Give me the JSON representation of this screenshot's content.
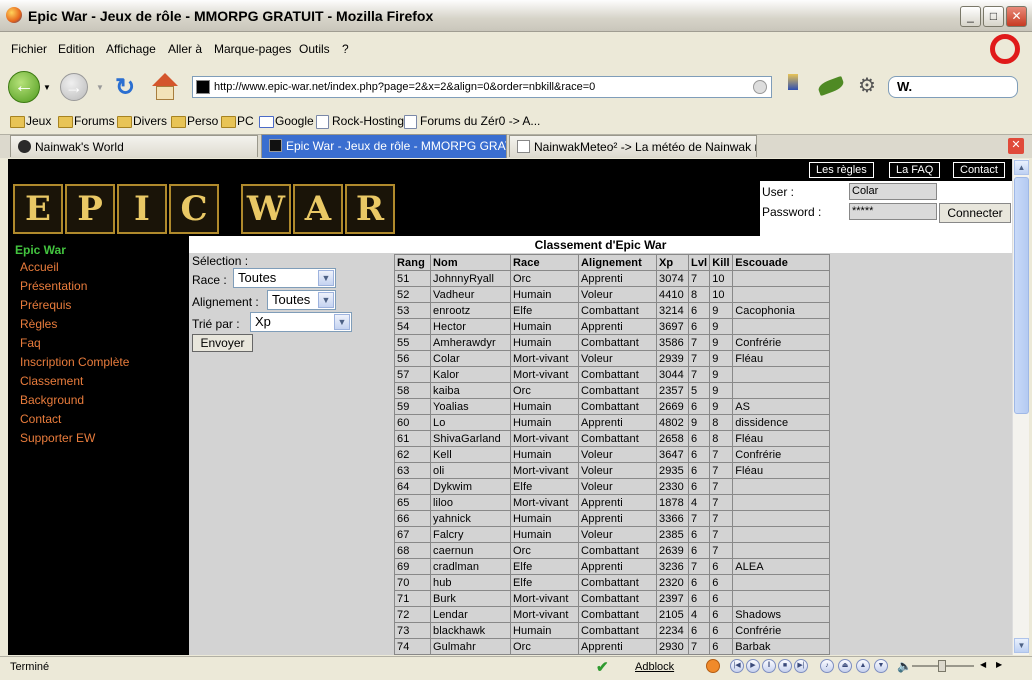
{
  "window": {
    "title": "Epic War - Jeux de rôle - MMORPG GRATUIT - Mozilla Firefox",
    "minimize": "_",
    "maximize": "□",
    "close": "✕"
  },
  "menu": [
    "Fichier",
    "Edition",
    "Affichage",
    "Aller à",
    "Marque-pages",
    "Outils",
    "?"
  ],
  "url": "http://www.epic-war.net/index.php?page=2&x=2&align=0&order=nbkill&race=0",
  "search_engine_label": "W.",
  "bookmarks": [
    {
      "label": "Jeux",
      "kind": "folder"
    },
    {
      "label": "Forums",
      "kind": "folder"
    },
    {
      "label": "Divers",
      "kind": "folder"
    },
    {
      "label": "Perso",
      "kind": "folder"
    },
    {
      "label": "PC",
      "kind": "folder"
    },
    {
      "label": "Google",
      "kind": "google"
    },
    {
      "label": "Rock-Hosting",
      "kind": "page"
    },
    {
      "label": "Forums du Zér0 -> A...",
      "kind": "page"
    }
  ],
  "tabs": [
    {
      "label": "Nainwak's World",
      "active": false
    },
    {
      "label": "Epic War - Jeux de rôle - MMORPG GRATUIT",
      "active": true
    },
    {
      "label": "NainwakMeteo² -> La météo de Nainwak re...",
      "active": false
    }
  ],
  "page": {
    "logo_letters": [
      "E",
      "P",
      "I",
      "C",
      "W",
      "A",
      "R"
    ],
    "top_links": [
      "Les règles",
      "La FAQ",
      "Contact"
    ],
    "login": {
      "user_label": "User :",
      "user_value": "Colar",
      "password_label": "Password :",
      "password_value": "*****",
      "connect_label": "Connecter"
    },
    "sidebar_title": "Epic War",
    "sidebar_items": [
      "Accueil",
      "Présentation",
      "Prérequis",
      "Règles",
      "Faq",
      "Inscription Complète",
      "Classement",
      "Background",
      "Contact",
      "Supporter EW"
    ],
    "ranking_title": "Classement d'Epic War",
    "filters": {
      "selection_label": "Sélection :",
      "race_label": "Race :",
      "race_value": "Toutes",
      "alignment_label": "Alignement :",
      "alignment_value": "Toutes",
      "sort_label": "Trié par :",
      "sort_value": "Xp",
      "submit_label": "Envoyer"
    },
    "table": {
      "headers": [
        "Rang",
        "Nom",
        "Race",
        "Alignement",
        "Xp",
        "Lvl",
        "Kill",
        "Escouade"
      ],
      "rows": [
        [
          "51",
          "JohnnyRyall",
          "Orc",
          "Apprenti",
          "3074",
          "7",
          "10",
          ""
        ],
        [
          "52",
          "Vadheur",
          "Humain",
          "Voleur",
          "4410",
          "8",
          "10",
          ""
        ],
        [
          "53",
          "enrootz",
          "Elfe",
          "Combattant",
          "3214",
          "6",
          "9",
          "Cacophonia"
        ],
        [
          "54",
          "Hector",
          "Humain",
          "Apprenti",
          "3697",
          "6",
          "9",
          ""
        ],
        [
          "55",
          "Amherawdyr",
          "Humain",
          "Combattant",
          "3586",
          "7",
          "9",
          "Confrérie"
        ],
        [
          "56",
          "Colar",
          "Mort-vivant",
          "Voleur",
          "2939",
          "7",
          "9",
          "Fléau"
        ],
        [
          "57",
          "Kalor",
          "Mort-vivant",
          "Combattant",
          "3044",
          "7",
          "9",
          ""
        ],
        [
          "58",
          "kaiba",
          "Orc",
          "Combattant",
          "2357",
          "5",
          "9",
          ""
        ],
        [
          "59",
          "Yoalias",
          "Humain",
          "Combattant",
          "2669",
          "6",
          "9",
          "AS"
        ],
        [
          "60",
          "Lo",
          "Humain",
          "Apprenti",
          "4802",
          "9",
          "8",
          "dissidence"
        ],
        [
          "61",
          "ShivaGarland",
          "Mort-vivant",
          "Combattant",
          "2658",
          "6",
          "8",
          "Fléau"
        ],
        [
          "62",
          "Kell",
          "Humain",
          "Voleur",
          "3647",
          "6",
          "7",
          "Confrérie"
        ],
        [
          "63",
          "oli",
          "Mort-vivant",
          "Voleur",
          "2935",
          "6",
          "7",
          "Fléau"
        ],
        [
          "64",
          "Dykwim",
          "Elfe",
          "Voleur",
          "2330",
          "6",
          "7",
          ""
        ],
        [
          "65",
          "liloo",
          "Mort-vivant",
          "Apprenti",
          "1878",
          "4",
          "7",
          ""
        ],
        [
          "66",
          "yahnick",
          "Humain",
          "Apprenti",
          "3366",
          "7",
          "7",
          ""
        ],
        [
          "67",
          "Falcry",
          "Humain",
          "Voleur",
          "2385",
          "6",
          "7",
          ""
        ],
        [
          "68",
          "caernun",
          "Orc",
          "Combattant",
          "2639",
          "6",
          "7",
          ""
        ],
        [
          "69",
          "cradlman",
          "Elfe",
          "Apprenti",
          "3236",
          "7",
          "6",
          "ALEA"
        ],
        [
          "70",
          "hub",
          "Elfe",
          "Combattant",
          "2320",
          "6",
          "6",
          ""
        ],
        [
          "71",
          "Burk",
          "Mort-vivant",
          "Combattant",
          "2397",
          "6",
          "6",
          ""
        ],
        [
          "72",
          "Lendar",
          "Mort-vivant",
          "Combattant",
          "2105",
          "4",
          "6",
          "Shadows"
        ],
        [
          "73",
          "blackhawk",
          "Humain",
          "Combattant",
          "2234",
          "6",
          "6",
          "Confrérie"
        ],
        [
          "74",
          "Gulmahr",
          "Orc",
          "Apprenti",
          "2930",
          "7",
          "6",
          "Barbak"
        ]
      ]
    }
  },
  "status": {
    "text": "Terminé",
    "adblock": "Adblock"
  },
  "colors": {
    "sidebar_title": "#43c43f",
    "sidebar_link": "#e97c3c",
    "logo_gold": "#e9c865",
    "active_tab": "#3a6ed0"
  }
}
